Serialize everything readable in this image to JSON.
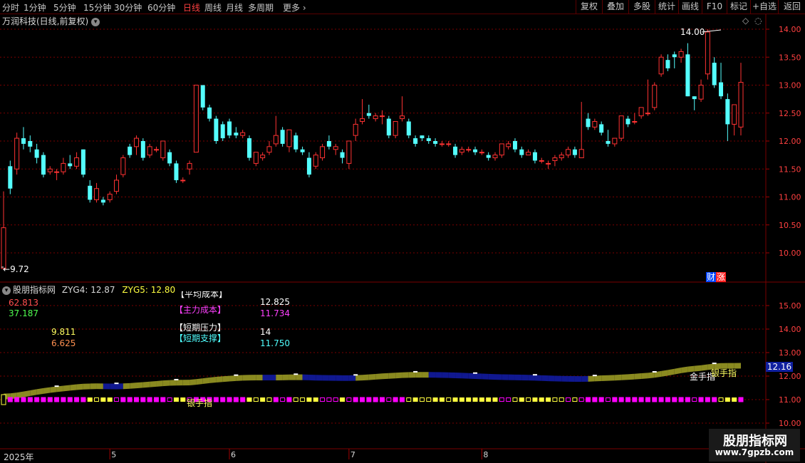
{
  "toolbar": {
    "timeframes": [
      "分时",
      "1分钟",
      "5分钟",
      "15分钟",
      "30分钟",
      "60分钟",
      "日线",
      "周线",
      "月线",
      "多周期",
      "更多"
    ],
    "active_timeframe": "日线",
    "right_buttons": [
      "复权",
      "叠加",
      "多股",
      "统计",
      "画线",
      "F10",
      "标记",
      "+自选",
      "返回"
    ]
  },
  "main_chart": {
    "title": "万润科技(日线,前复权)",
    "price_axis": [
      "14.00",
      "13.50",
      "13.00",
      "12.50",
      "12.00",
      "11.50",
      "11.00",
      "10.50",
      "10.00"
    ],
    "high_marker": "14.00",
    "low_marker": "9.72",
    "badge_a": "财",
    "badge_b": "涨"
  },
  "indicator": {
    "name": "股朋指标网",
    "zyg4_label": "ZYG4:",
    "zyg4_value": "12.87",
    "zyg5_label": "ZYG5:",
    "zyg5_value": "12.80",
    "left_values": [
      "62.813",
      "37.187",
      "9.811",
      "6.625"
    ],
    "avg_cost_label": "【平均成本】",
    "avg_cost_value": "12.825",
    "main_cost_label": "【主力成本】",
    "main_cost_value": "11.734",
    "short_pressure_label": "【短期压力】",
    "short_pressure_value": "14",
    "short_support_label": "【短期支撑】",
    "short_support_value": "11.750",
    "axis": [
      "15.00",
      "14.00",
      "13.00",
      "12.00",
      "11.00",
      "10.00"
    ],
    "current_value": "12.16",
    "silver_label": "银手指",
    "gold_label": "金手指"
  },
  "date_axis": {
    "year": "2025年",
    "months": [
      "5",
      "6",
      "7",
      "8"
    ]
  },
  "watermark": {
    "title": "股朋指标网",
    "url": "www.7gpzb.com"
  },
  "colors": {
    "up": "#ff3232",
    "down": "#54ffff",
    "grid": "#7a0000",
    "olive": "#8a8a20",
    "navy": "#101890",
    "magenta": "#ff00ff",
    "yellow": "#ffff40"
  },
  "chart_data": {
    "type": "candlestick",
    "candles": [
      [
        9.72,
        10.45,
        11.1,
        9.72
      ],
      [
        11.55,
        11.15,
        11.65,
        11.05
      ],
      [
        11.5,
        12.05,
        12.15,
        11.4
      ],
      [
        12.05,
        11.95,
        12.25,
        11.85
      ],
      [
        12.0,
        11.9,
        12.1,
        11.8
      ],
      [
        11.85,
        11.7,
        11.95,
        11.6
      ],
      [
        11.75,
        11.4,
        11.8,
        11.35
      ],
      [
        11.45,
        11.5,
        11.55,
        11.4
      ],
      [
        11.45,
        11.45,
        11.5,
        11.3
      ],
      [
        11.45,
        11.6,
        11.7,
        11.4
      ],
      [
        11.6,
        11.55,
        11.75,
        11.5
      ],
      [
        11.55,
        11.7,
        11.8,
        11.5
      ],
      [
        11.85,
        11.4,
        11.85,
        11.35
      ],
      [
        11.2,
        10.95,
        11.3,
        10.9
      ],
      [
        10.95,
        11.15,
        11.25,
        10.9
      ],
      [
        10.95,
        10.9,
        11.0,
        10.85
      ],
      [
        10.95,
        11.05,
        11.1,
        10.9
      ],
      [
        11.1,
        11.3,
        11.4,
        11.05
      ],
      [
        11.4,
        11.7,
        11.75,
        11.35
      ],
      [
        11.9,
        11.75,
        11.95,
        11.7
      ],
      [
        11.9,
        12.05,
        12.1,
        11.75
      ],
      [
        12.0,
        11.7,
        12.05,
        11.65
      ],
      [
        11.75,
        11.9,
        11.95,
        11.7
      ],
      [
        11.85,
        11.85,
        11.9,
        11.8
      ],
      [
        11.7,
        12.0,
        12.0,
        11.65
      ],
      [
        11.8,
        11.6,
        11.85,
        11.55
      ],
      [
        11.6,
        11.3,
        11.65,
        11.25
      ],
      [
        11.3,
        11.3,
        11.35,
        11.25
      ],
      [
        11.5,
        11.6,
        11.65,
        11.4
      ],
      [
        11.8,
        13.0,
        13.0,
        11.8
      ],
      [
        13.0,
        12.6,
        13.0,
        12.55
      ],
      [
        12.6,
        12.4,
        12.65,
        12.35
      ],
      [
        12.4,
        12.0,
        12.45,
        11.95
      ],
      [
        12.3,
        12.05,
        12.35,
        12.0
      ],
      [
        12.35,
        12.1,
        12.4,
        12.05
      ],
      [
        12.15,
        12.1,
        12.25,
        12.05
      ],
      [
        12.1,
        12.15,
        12.2,
        12.05
      ],
      [
        12.05,
        11.7,
        12.1,
        11.65
      ],
      [
        11.6,
        11.8,
        11.8,
        11.55
      ],
      [
        11.7,
        11.75,
        11.8,
        11.65
      ],
      [
        11.8,
        11.9,
        12.0,
        11.75
      ],
      [
        11.95,
        12.1,
        12.45,
        11.9
      ],
      [
        12.2,
        11.95,
        12.25,
        11.9
      ],
      [
        11.9,
        12.2,
        12.2,
        11.8
      ],
      [
        12.1,
        11.85,
        12.15,
        11.8
      ],
      [
        11.85,
        11.8,
        11.9,
        11.75
      ],
      [
        11.7,
        11.4,
        11.8,
        11.35
      ],
      [
        11.55,
        11.75,
        11.8,
        11.5
      ],
      [
        11.7,
        11.9,
        11.95,
        11.65
      ],
      [
        12.0,
        11.9,
        12.1,
        11.85
      ],
      [
        11.85,
        11.9,
        11.95,
        11.75
      ],
      [
        11.8,
        11.7,
        11.85,
        11.6
      ],
      [
        11.6,
        12.0,
        12.0,
        11.5
      ],
      [
        12.1,
        12.3,
        12.4,
        12.0
      ],
      [
        12.35,
        12.4,
        12.75,
        12.3
      ],
      [
        12.5,
        12.45,
        12.65,
        12.4
      ],
      [
        12.4,
        12.45,
        12.5,
        12.35
      ],
      [
        12.45,
        12.45,
        12.55,
        12.3
      ],
      [
        12.4,
        12.1,
        12.45,
        12.05
      ],
      [
        12.1,
        12.35,
        12.35,
        12.05
      ],
      [
        12.4,
        12.45,
        12.8,
        12.35
      ],
      [
        12.35,
        12.1,
        12.4,
        12.05
      ],
      [
        12.05,
        11.95,
        12.1,
        11.9
      ],
      [
        12.1,
        12.05,
        12.1,
        12.0
      ],
      [
        12.05,
        12.0,
        12.1,
        11.95
      ],
      [
        12.0,
        11.95,
        12.05,
        11.9
      ],
      [
        11.95,
        11.95,
        12.0,
        11.9
      ],
      [
        11.95,
        11.95,
        12.0,
        11.9
      ],
      [
        11.9,
        11.75,
        11.95,
        11.7
      ],
      [
        11.8,
        11.85,
        11.9,
        11.75
      ],
      [
        11.85,
        11.85,
        11.9,
        11.8
      ],
      [
        11.85,
        11.8,
        11.9,
        11.75
      ],
      [
        11.8,
        11.8,
        11.85,
        11.75
      ],
      [
        11.75,
        11.7,
        11.8,
        11.65
      ],
      [
        11.7,
        11.75,
        11.8,
        11.65
      ],
      [
        11.75,
        11.95,
        11.95,
        11.7
      ],
      [
        11.9,
        11.95,
        12.0,
        11.85
      ],
      [
        12.0,
        11.85,
        12.05,
        11.8
      ],
      [
        11.85,
        11.75,
        11.9,
        11.7
      ],
      [
        11.75,
        11.8,
        11.85,
        11.75
      ],
      [
        11.8,
        11.65,
        11.85,
        11.6
      ],
      [
        11.65,
        11.65,
        11.7,
        11.6
      ],
      [
        11.6,
        11.6,
        11.65,
        11.5
      ],
      [
        11.65,
        11.7,
        11.75,
        11.55
      ],
      [
        11.7,
        11.75,
        11.8,
        11.65
      ],
      [
        11.75,
        11.85,
        11.9,
        11.7
      ],
      [
        11.85,
        11.75,
        11.9,
        11.7
      ],
      [
        11.7,
        11.85,
        12.7,
        11.7
      ],
      [
        12.4,
        12.25,
        12.5,
        12.2
      ],
      [
        12.25,
        12.35,
        12.4,
        12.2
      ],
      [
        12.3,
        12.15,
        12.35,
        12.1
      ],
      [
        12.0,
        11.95,
        12.2,
        11.9
      ],
      [
        11.95,
        12.05,
        12.05,
        11.9
      ],
      [
        12.05,
        12.45,
        12.45,
        12.0
      ],
      [
        12.4,
        12.3,
        12.45,
        12.25
      ],
      [
        12.35,
        12.35,
        12.5,
        12.3
      ],
      [
        12.45,
        12.6,
        12.6,
        12.4
      ],
      [
        12.5,
        12.5,
        13.1,
        12.45
      ],
      [
        12.6,
        13.0,
        13.05,
        12.55
      ],
      [
        13.2,
        13.5,
        13.55,
        13.15
      ],
      [
        13.45,
        13.3,
        13.55,
        13.25
      ],
      [
        13.55,
        13.5,
        13.6,
        13.3
      ],
      [
        13.5,
        13.6,
        13.65,
        13.4
      ],
      [
        13.55,
        12.8,
        13.75,
        12.8
      ],
      [
        12.8,
        12.75,
        12.8,
        12.55
      ],
      [
        12.75,
        13.0,
        13.1,
        12.7
      ],
      [
        13.2,
        13.95,
        14.0,
        13.1
      ],
      [
        13.4,
        13.0,
        13.5,
        12.95
      ],
      [
        13.05,
        12.8,
        13.4,
        12.75
      ],
      [
        12.75,
        12.3,
        12.85,
        12.0
      ],
      [
        12.3,
        12.65,
        12.65,
        12.1
      ],
      [
        12.25,
        13.05,
        13.4,
        12.1
      ]
    ]
  }
}
